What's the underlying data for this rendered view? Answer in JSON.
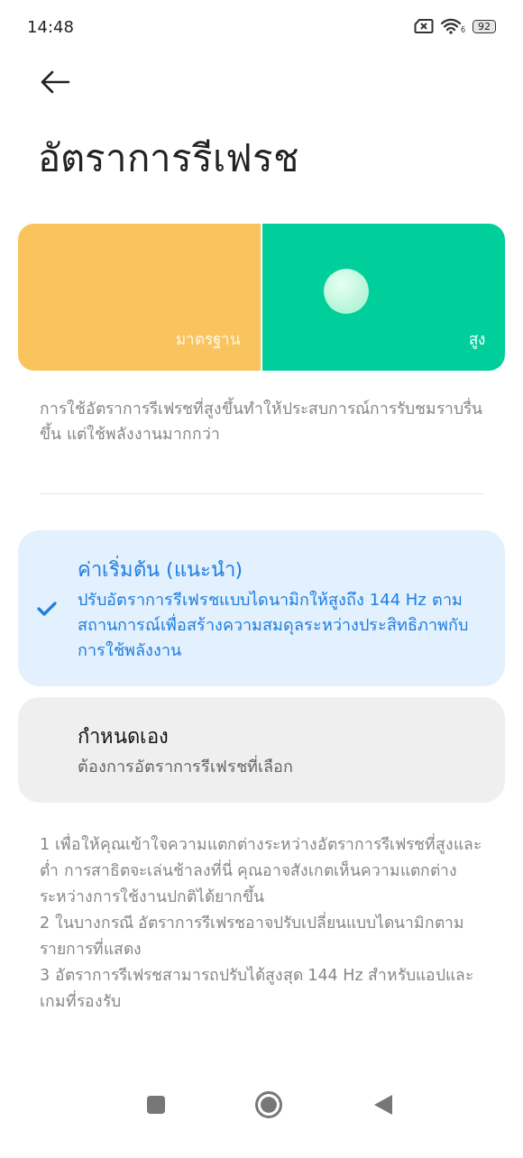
{
  "status_bar": {
    "time": "14:48",
    "battery": "92",
    "wifi_badge": "6"
  },
  "title": "อัตราการรีเฟรช",
  "preview": {
    "segments": [
      {
        "label": "มาตรฐาน",
        "selected": false,
        "color": "#f9c45e"
      },
      {
        "label": "สูง",
        "selected": true,
        "color": "#00cf9b"
      }
    ]
  },
  "description": "การใช้อัตราการรีเฟรชที่สูงขึ้นทำให้ประสบการณ์การรับชมราบรื่นขึ้น แต่ใช้พลังงานมากกว่า",
  "options": [
    {
      "title": "ค่าเริ่มต้น (แนะนำ)",
      "subtitle": "ปรับอัตราการรีเฟรชแบบไดนามิกให้สูงถึง 144 Hz ตามสถานการณ์เพื่อสร้างความสมดุลระหว่างประสิทธิภาพกับการใช้พลังงาน",
      "selected": true
    },
    {
      "title": "กำหนดเอง",
      "subtitle": "ต้องการอัตราการรีเฟรชที่เลือก",
      "selected": false
    }
  ],
  "notes": [
    "1 เพื่อให้คุณเข้าใจความแตกต่างระหว่างอัตราการรีเฟรชที่สูงและต่ำ การสาธิตจะเล่นช้าลงที่นี่ คุณอาจสังเกตเห็นความแตกต่างระหว่างการใช้งานปกติได้ยากขึ้น",
    "2 ในบางกรณี อัตราการรีเฟรชอาจปรับเปลี่ยนแบบไดนามิกตามรายการที่แสดง",
    "3 อัตราการรีเฟรชสามารถปรับได้สูงสุด 144 Hz สำหรับแอปและเกมที่รองรับ"
  ]
}
